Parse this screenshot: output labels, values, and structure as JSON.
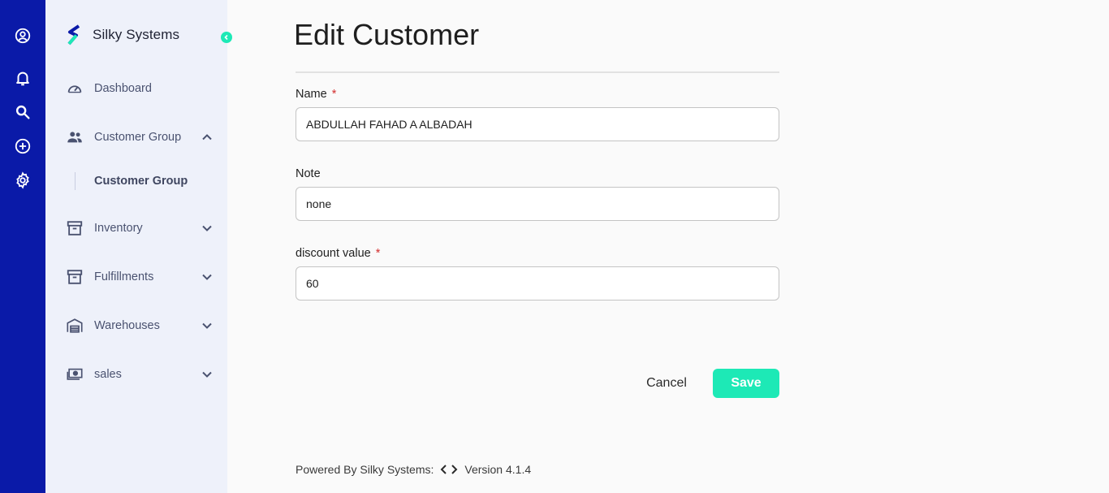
{
  "rail": {
    "items": [
      {
        "name": "account-icon"
      },
      {
        "name": "bell-icon"
      },
      {
        "name": "search-icon"
      },
      {
        "name": "add-circle-icon"
      },
      {
        "name": "gear-icon"
      }
    ]
  },
  "sidebar": {
    "brand": "Silky Systems",
    "items": [
      {
        "label": "Dashboard",
        "icon": "dashboard-gauge-icon"
      },
      {
        "label": "Customer Group",
        "icon": "people-icon",
        "expanded": true
      },
      {
        "label": "Inventory",
        "icon": "archive-box-icon",
        "expanded": false
      },
      {
        "label": "Fulfillments",
        "icon": "archive-box-icon",
        "expanded": false
      },
      {
        "label": "Warehouses",
        "icon": "warehouse-icon",
        "expanded": false
      },
      {
        "label": "sales",
        "icon": "cash-icon",
        "expanded": false
      }
    ],
    "sub_items": [
      {
        "label": "Customer Group",
        "active": true
      }
    ]
  },
  "main": {
    "title": "Edit Customer",
    "fields": [
      {
        "label": "Name",
        "required": true,
        "value": "ABDULLAH FAHAD A ALBADAH"
      },
      {
        "label": "Note",
        "required": false,
        "value": "none"
      },
      {
        "label": "discount value",
        "required": true,
        "value": "60"
      }
    ],
    "required_mark": "*",
    "cancel_label": "Cancel",
    "save_label": "Save"
  },
  "footer": {
    "powered_by": "Powered By Silky Systems:",
    "version": "Version 4.1.4"
  },
  "colors": {
    "rail": "#0a1aa8",
    "sidebar": "#eef1fa",
    "accent": "#1de9b6",
    "required": "#d32f2f"
  }
}
